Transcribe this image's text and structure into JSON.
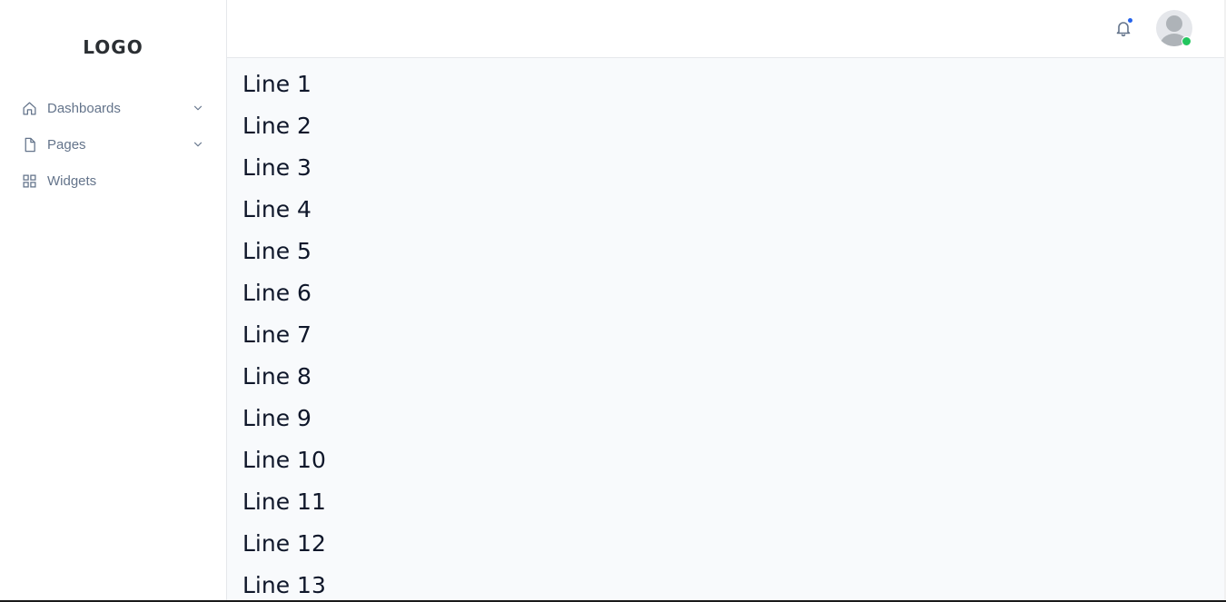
{
  "sidebar": {
    "logo": "LOGO",
    "items": [
      {
        "label": "Dashboards",
        "icon": "home-icon",
        "has_chevron": true
      },
      {
        "label": "Pages",
        "icon": "file-icon",
        "has_chevron": true
      },
      {
        "label": "Widgets",
        "icon": "grid-icon",
        "has_chevron": false
      }
    ]
  },
  "header": {
    "notification_icon": "bell-icon",
    "notification_unread": true,
    "user_status": "online"
  },
  "main": {
    "lines": [
      "Line 1",
      "Line 2",
      "Line 3",
      "Line 4",
      "Line 5",
      "Line 6",
      "Line 7",
      "Line 8",
      "Line 9",
      "Line 10",
      "Line 11",
      "Line 12",
      "Line 13"
    ]
  },
  "colors": {
    "accent": "#2563eb",
    "online": "#22c55e",
    "nav_text": "#64748b",
    "content_text": "#0f172a",
    "content_bg": "#f8fafc"
  }
}
